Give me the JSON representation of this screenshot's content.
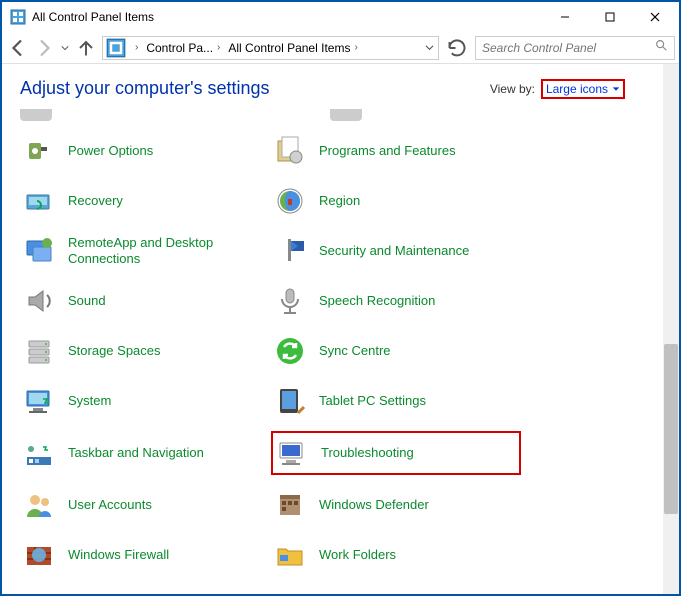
{
  "window": {
    "title": "All Control Panel Items"
  },
  "breadcrumbs": {
    "item1": "Control Pa...",
    "item2": "All Control Panel Items"
  },
  "search": {
    "placeholder": "Search Control Panel"
  },
  "heading": "Adjust your computer's settings",
  "viewby": {
    "label": "View by:",
    "value": "Large icons"
  },
  "items": {
    "left": [
      "Power Options",
      "Recovery",
      "RemoteApp and Desktop Connections",
      "Sound",
      "Storage Spaces",
      "System",
      "Taskbar and Navigation",
      "User Accounts",
      "Windows Firewall"
    ],
    "right": [
      "Programs and Features",
      "Region",
      "Security and Maintenance",
      "Speech Recognition",
      "Sync Centre",
      "Tablet PC Settings",
      "Troubleshooting",
      "Windows Defender",
      "Work Folders"
    ]
  }
}
